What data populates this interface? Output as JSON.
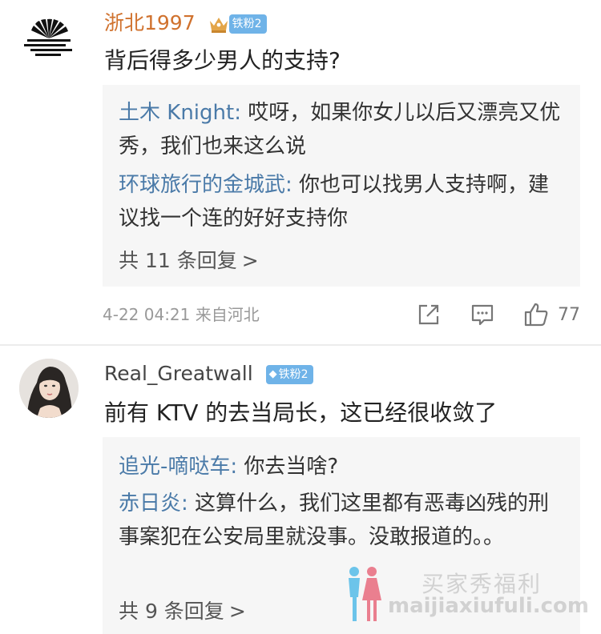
{
  "comments": [
    {
      "username": "浙北1997",
      "badge": "铁粉2",
      "text": "背后得多少男人的支持?",
      "replies": [
        {
          "name": "土木 Knight:",
          "text": " 哎呀，如果你女儿以后又漂亮又优秀，我们也来这么说"
        },
        {
          "name": "环球旅行的金城武:",
          "text": " 你也可以找男人支持啊，建议找一个连的好好支持你"
        }
      ],
      "reply_count": "共 11 条回复",
      "reply_arrow": ">",
      "timestamp": "4-22 04:21",
      "location": "来自河北",
      "like_count": "77"
    },
    {
      "username": "Real_Greatwall",
      "badge": "铁粉2",
      "text": "前有 KTV 的去当局长，这已经很收敛了",
      "replies": [
        {
          "name": "追光-嘀哒车:",
          "text": " 你去当啥?"
        },
        {
          "name": "赤日炎:",
          "text": " 这算什么，我们这里都有恶毒凶残的刑事案犯在公安局里就没事。没敢报道的。。"
        }
      ],
      "reply_count": "共 9 条回复",
      "reply_arrow": ">"
    }
  ],
  "watermark": {
    "cn": "买家秀福利",
    "en": "maijiaxiufuli.com"
  },
  "colors": {
    "username_highlight": "#d0722e",
    "reply_name": "#4a7aa8",
    "badge_blue": "#6fb3e8",
    "reply_bg": "#f6f6f6",
    "meta_gray": "#999999"
  },
  "icons": [
    "crown-icon",
    "diamond-icon",
    "share-icon",
    "comment-icon",
    "thumbs-up-icon"
  ]
}
